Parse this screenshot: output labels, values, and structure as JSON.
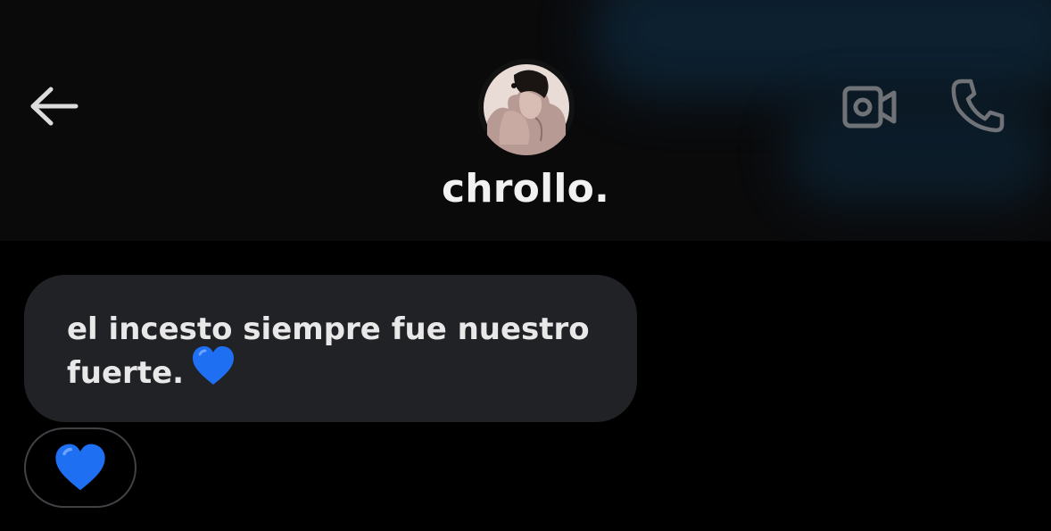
{
  "header": {
    "username": "chrollo.",
    "back_icon": "arrow-left-icon",
    "video_icon": "video-camera-icon",
    "call_icon": "phone-icon"
  },
  "message": {
    "lines": [
      "el incesto siempre fue nuestro",
      "fuerte."
    ],
    "emoji": "blue-heart",
    "reaction": "blue-heart"
  },
  "colors": {
    "background": "#000000",
    "header_background": "#0a0a0b",
    "bubble": "#212225",
    "text": "#e8e8e8",
    "icon": "#dcdcdc",
    "icon_muted": "#6f7378",
    "heart": "#1e6ff2"
  }
}
